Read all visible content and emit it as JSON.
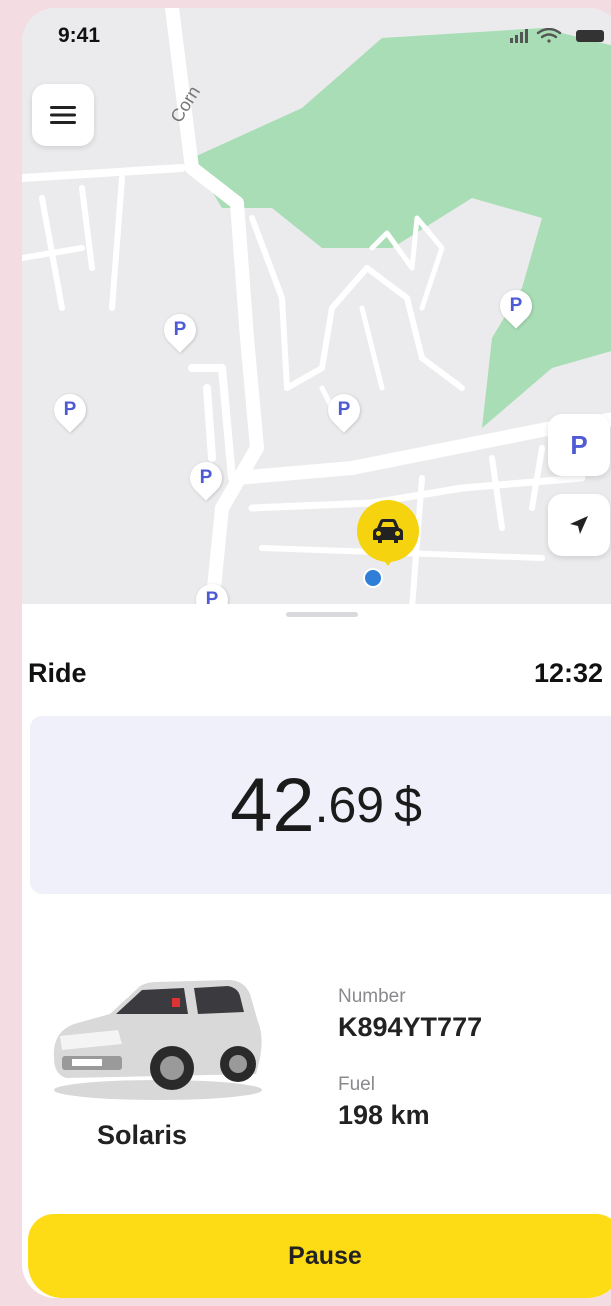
{
  "status_bar": {
    "time": "9:41"
  },
  "map": {
    "street_label": "Corn",
    "parking_pin_label": "P",
    "parking_button_label": "P",
    "icons": [
      "menu-icon",
      "parking-icon",
      "location-arrow-icon",
      "car-icon",
      "user-location-icon"
    ]
  },
  "ride": {
    "title": "Ride",
    "time": "12:32"
  },
  "price": {
    "integer": "42",
    "decimal": ".69",
    "currency": "$"
  },
  "car": {
    "model": "Solaris",
    "number_label": "Number",
    "number_value": "K894YT777",
    "fuel_label": "Fuel",
    "fuel_value": "198 km"
  },
  "actions": {
    "pause_label": "Pause"
  },
  "colors": {
    "accent": "#FDDC16",
    "parking": "#4F5BD5",
    "park_green": "#A8DDB5",
    "price_bg": "#F0F0FB",
    "location_dot": "#2F7ED8"
  }
}
